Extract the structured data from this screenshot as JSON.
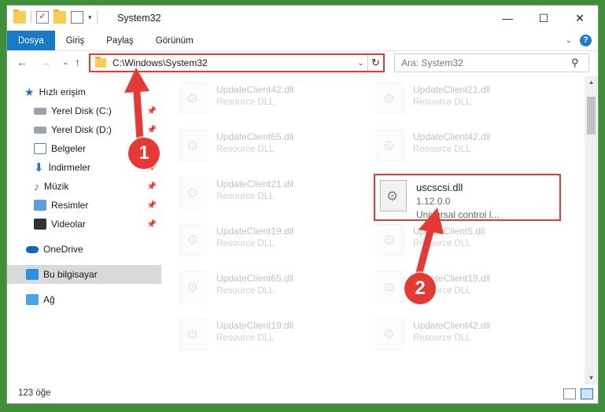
{
  "window": {
    "title": "System32",
    "controls": {
      "minimize": "—",
      "maximize": "☐",
      "close": "✕"
    }
  },
  "ribbon": {
    "tabs": [
      "Dosya",
      "Giriş",
      "Paylaş",
      "Görünüm"
    ],
    "help": "?"
  },
  "address": {
    "path": "C:\\Windows\\System32"
  },
  "search": {
    "placeholder": "Ara: System32"
  },
  "sidebar": {
    "quick_access": "Hızlı erişim",
    "items": [
      {
        "label": "Yerel Disk (C:)",
        "icon": "drive-icon",
        "pinned": true
      },
      {
        "label": "Yerel Disk (D:)",
        "icon": "drive-icon",
        "pinned": true
      },
      {
        "label": "Belgeler",
        "icon": "documents-icon",
        "pinned": true
      },
      {
        "label": "İndirmeler",
        "icon": "downloads-icon",
        "pinned": true
      },
      {
        "label": "Müzik",
        "icon": "music-icon",
        "pinned": true
      },
      {
        "label": "Resimler",
        "icon": "pictures-icon",
        "pinned": true
      },
      {
        "label": "Videolar",
        "icon": "videos-icon",
        "pinned": true
      }
    ],
    "onedrive": "OneDrive",
    "this_pc": "Bu bilgisayar",
    "network": "Ağ"
  },
  "files": {
    "left": [
      {
        "name": "UpdateClient42.dll",
        "type": "Resource DLL"
      },
      {
        "name": "UpdateClient65.dll",
        "type": "Resource DLL"
      },
      {
        "name": "UpdateClient21.dll",
        "type": "Resource DLL"
      },
      {
        "name": "UpdateClient19.dll",
        "type": "Resource DLL"
      },
      {
        "name": "UpdateClient65.dll",
        "type": "Resource DLL"
      },
      {
        "name": "UpdateClient19.dll",
        "type": "Resource DLL"
      }
    ],
    "right": [
      {
        "name": "UpdateClient21.dll",
        "type": "Resource DLL"
      },
      {
        "name": "UpdateClient42.dll",
        "type": "Resource DLL"
      },
      {
        "name": "UpdateClient5.dll",
        "type": "Resource DLL"
      },
      {
        "name": "UpdateClient19.dll",
        "type": "Resource DLL"
      },
      {
        "name": "UpdateClient42.dll",
        "type": "Resource DLL"
      }
    ],
    "highlighted": {
      "name": "uscscsi.dll",
      "version": "1.12.0.0",
      "description": "Universal control l..."
    }
  },
  "status": {
    "count": "123 öğe"
  },
  "annotations": {
    "step1": "1",
    "step2": "2",
    "color": "#e53935"
  }
}
